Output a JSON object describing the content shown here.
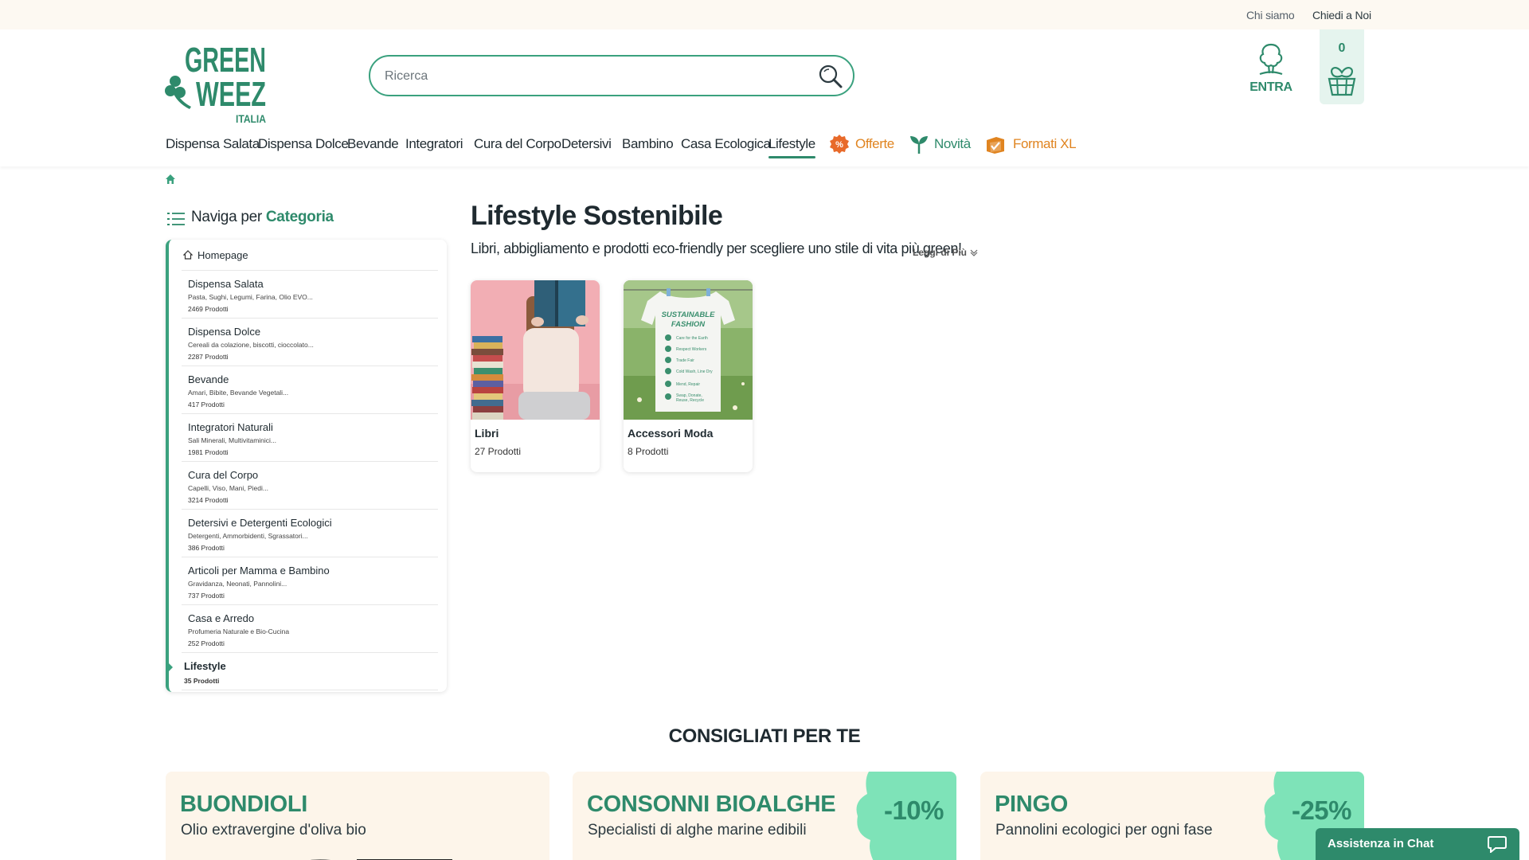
{
  "topbar": {
    "about": "Chi siamo",
    "ask": "Chiedi a Noi"
  },
  "logo": {
    "line1": "GREEN",
    "line2": "WEEZ",
    "line3": "ITALIA"
  },
  "search": {
    "placeholder": "Ricerca"
  },
  "account": {
    "label": "ENTRA"
  },
  "cart": {
    "count": "0"
  },
  "nav": {
    "items": [
      "Dispensa Salata",
      "Dispensa Dolce",
      "Bevande",
      "Integratori",
      "Cura del Corpo",
      "Detersivi",
      "Bambino",
      "Casa Ecologica",
      "Lifestyle"
    ],
    "offers": "Offerte",
    "new": "Novità",
    "xl": "Formati XL"
  },
  "sidebar": {
    "title_prefix": "Naviga per",
    "title_highlight": "Categoria",
    "home": "Homepage",
    "categories": [
      {
        "name": "Dispensa Salata",
        "desc": "Pasta, Sughi, Legumi, Farina, Olio EVO...",
        "count": "2469 Prodotti"
      },
      {
        "name": "Dispensa Dolce",
        "desc": "Cereali da colazione, biscotti, cioccolato...",
        "count": "2287 Prodotti"
      },
      {
        "name": "Bevande",
        "desc": "Amari, Bibite, Bevande Vegetali...",
        "count": "417 Prodotti"
      },
      {
        "name": "Integratori Naturali",
        "desc": "Sali Minerali, Multivitaminici...",
        "count": "1981 Prodotti"
      },
      {
        "name": "Cura del Corpo",
        "desc": "Capelli, Viso, Mani, Piedi...",
        "count": "3214 Prodotti"
      },
      {
        "name": "Detersivi e Detergenti Ecologici",
        "desc": "Detergenti, Ammorbidenti, Sgrassatori...",
        "count": "386 Prodotti"
      },
      {
        "name": "Articoli per Mamma e Bambino",
        "desc": "Gravidanza, Neonati, Pannolini...",
        "count": "737 Prodotti"
      },
      {
        "name": "Casa e Arredo",
        "desc": "Profumeria Naturale e Bio-Cucina",
        "count": "252 Prodotti"
      }
    ],
    "active": {
      "name": "Lifestyle",
      "count": "35 Prodotti"
    }
  },
  "main": {
    "title": "Lifestyle Sostenibile",
    "lead": "Libri, abbigliamento e prodotti eco-friendly per scegliere uno stile di vita più green!",
    "read_more": "Leggi di Più",
    "subcategories": [
      {
        "name": "Libri",
        "count": "27 Prodotti"
      },
      {
        "name": "Accessori Moda",
        "count": "8 Prodotti"
      }
    ],
    "tshirt_lines": {
      "head1": "SUSTAINABLE",
      "head2": "FASHION",
      "l1": "Care for the Earth",
      "l2": "Respect Workers",
      "l3": "Trade Fair",
      "l4": "Cold Wash, Line Dry",
      "l5": "Mend, Repair",
      "l6": "Swap, Donate,",
      "l7": "Reuse, Recycle"
    }
  },
  "recommended": {
    "title": "CONSIGLIATI PER TE",
    "promos": [
      {
        "brand": "BUONDIOLI",
        "sub": "Olio extravergine d'oliva bio",
        "discount": ""
      },
      {
        "brand": "CONSONNI BIOALGHE",
        "sub": "Specialisti di alghe marine edibili",
        "discount": "-10%"
      },
      {
        "brand": "PINGO",
        "sub": "Pannolini ecologici per ogni fase",
        "discount": "-25%"
      }
    ]
  },
  "chat": {
    "label": "Assistenza in Chat"
  },
  "colors": {
    "brand_green": "#2e8a6b",
    "accent_orange": "#e08420",
    "topbar_bg": "#fdf9f2",
    "promo_bg": "#fdf5ea"
  }
}
